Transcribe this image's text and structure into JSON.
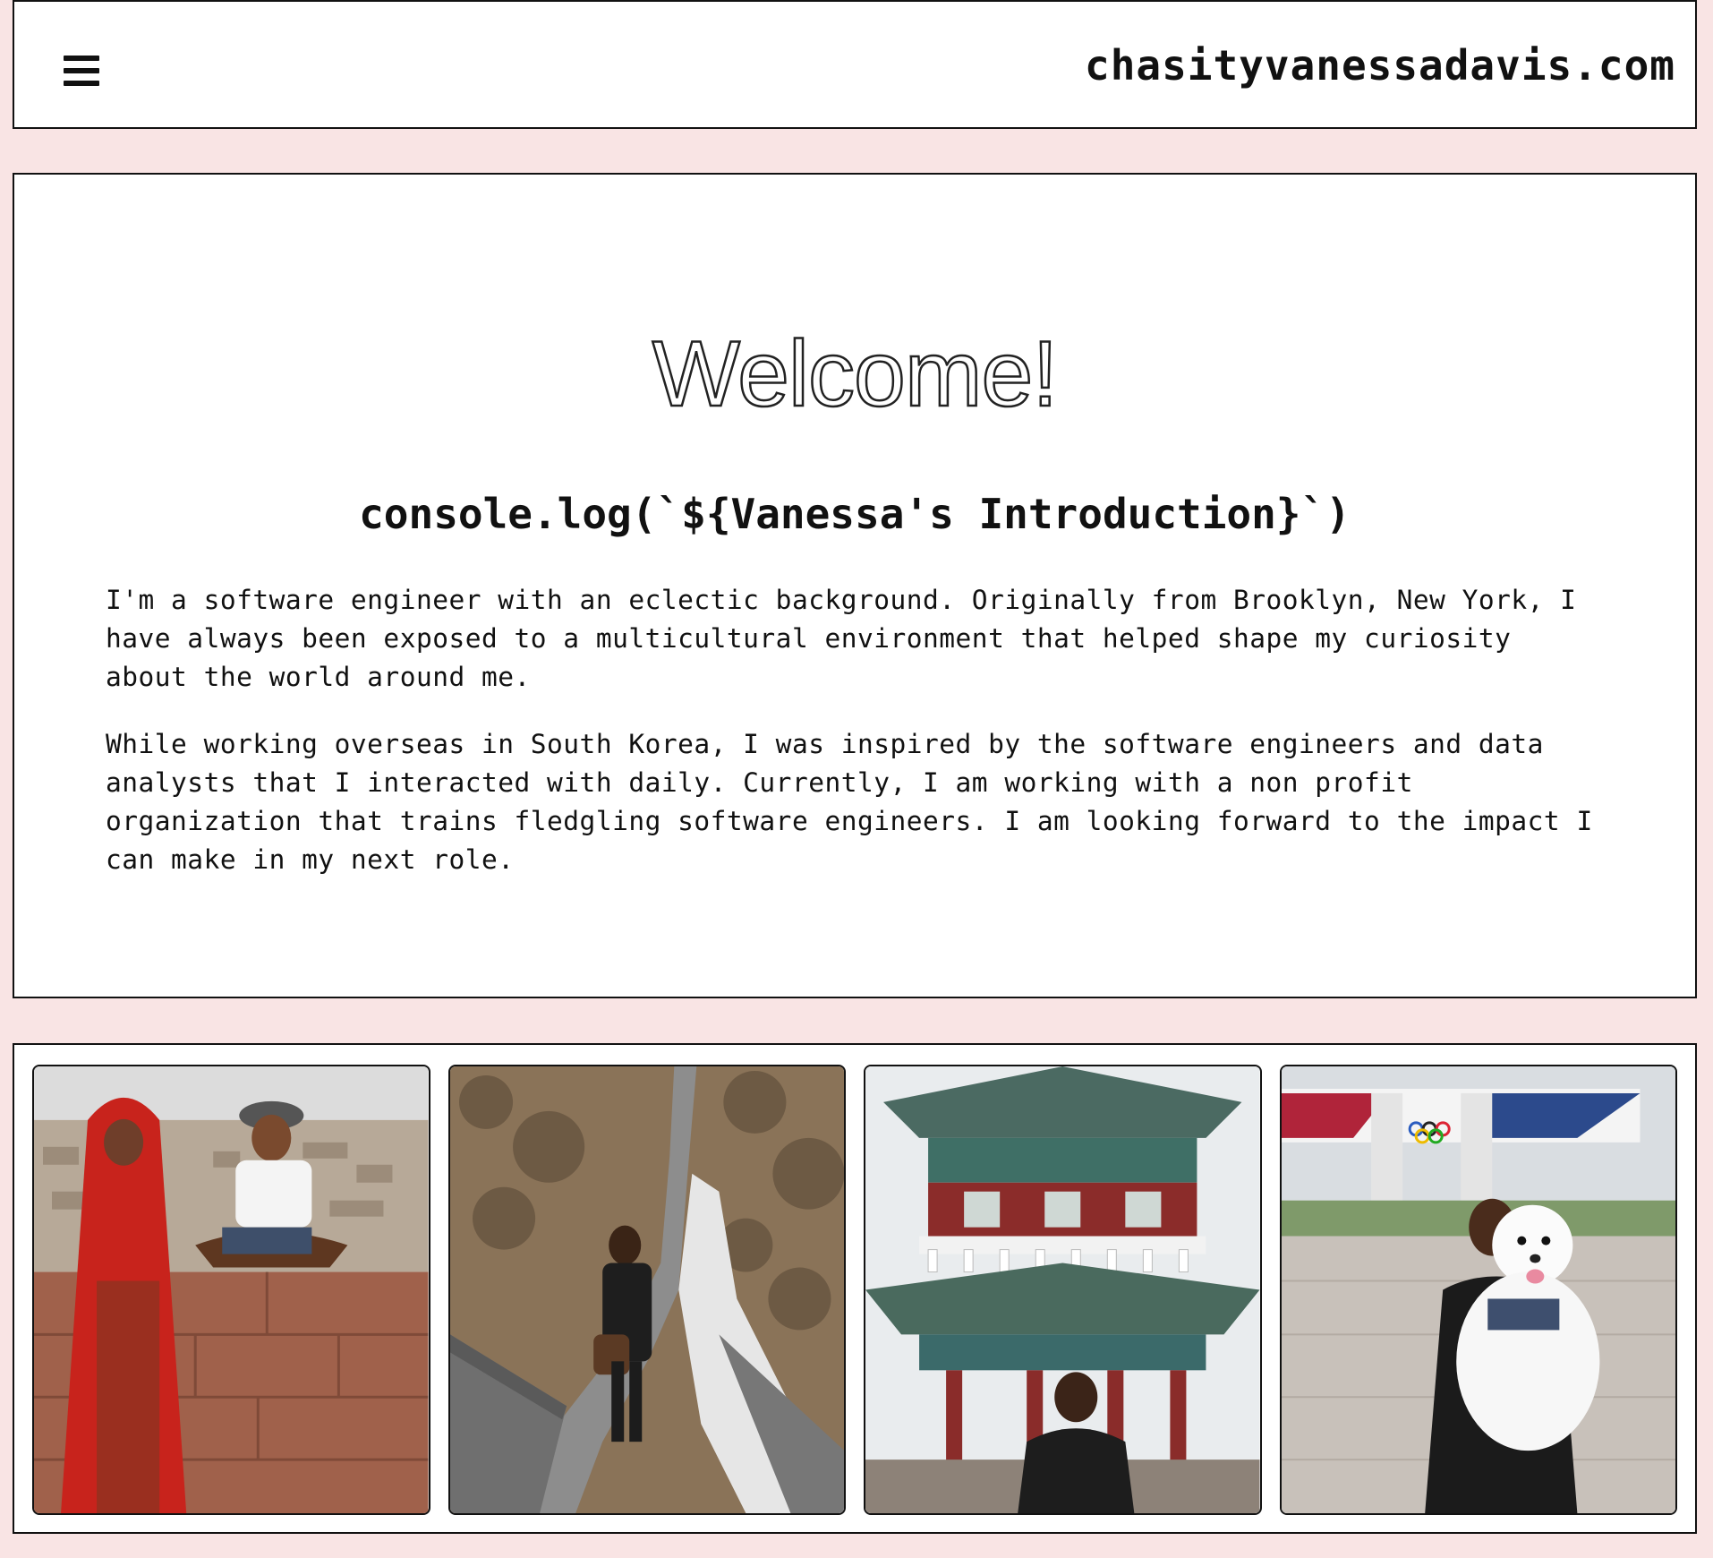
{
  "header": {
    "site_title": "chasityvanessadavis.com",
    "menu_icon": "hamburger-menu-icon"
  },
  "intro": {
    "welcome": "Welcome!",
    "heading": "console.log(`${Vanessa's Introduction}`)",
    "paragraphs": [
      "I'm a software engineer with an eclectic background. Originally from Brooklyn, New York, I have always been exposed to a multicultural environment that helped shape my curiosity about the world around me.",
      "While working overseas in South Korea, I was inspired by the software engineers and data analysts that I interacted with daily. Currently, I am working with a non profit organization that trains fledgling software engineers. I am looking forward to the impact I can make in my next role."
    ]
  },
  "gallery": {
    "photos": [
      "photo-rooftop-india",
      "photo-great-wall",
      "photo-korean-pagoda",
      "photo-olympic-park-dog"
    ]
  },
  "colors": {
    "page_background": "#f9e4e4",
    "border": "#111111",
    "panel": "#ffffff"
  }
}
